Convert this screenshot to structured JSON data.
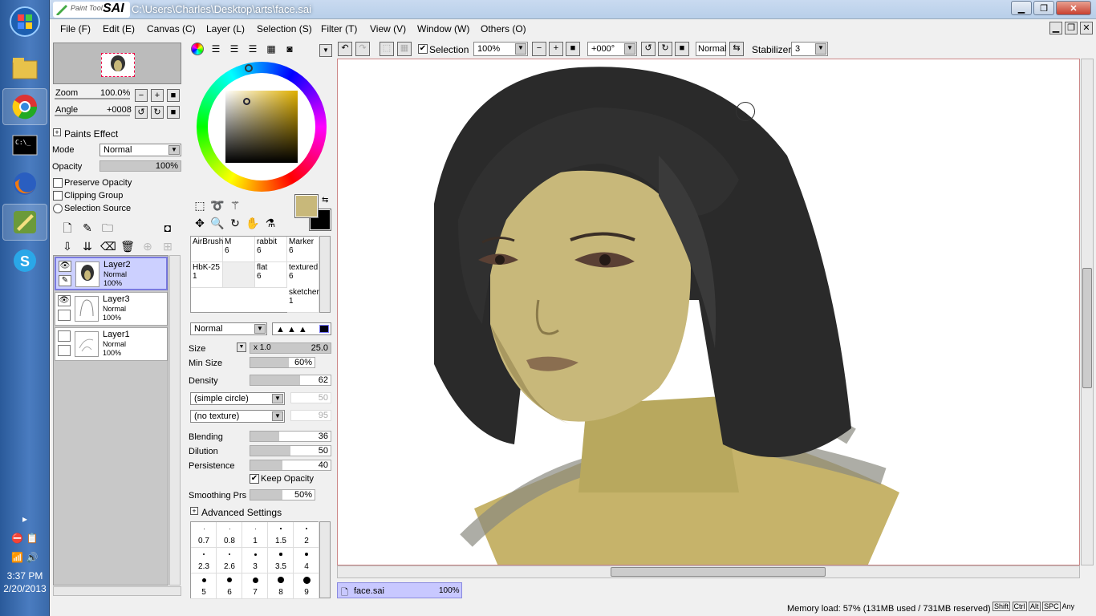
{
  "titlebar": {
    "path": "C:\\Users\\Charles\\Desktop\\arts\\face.sai",
    "logo_top": "Paint Tool",
    "logo_main": "SAI"
  },
  "menu": [
    "File (F)",
    "Edit (E)",
    "Canvas (C)",
    "Layer (L)",
    "Selection (S)",
    "Filter (T)",
    "View (V)",
    "Window (W)",
    "Others (O)"
  ],
  "toolbar": {
    "selection_label": "Selection",
    "zoom": "100%",
    "angle": "+000°",
    "blend": "Normal",
    "stabilizer_label": "Stabilizer",
    "stabilizer_value": "3"
  },
  "navigator": {
    "zoom_label": "Zoom",
    "zoom_value": "100.0%",
    "angle_label": "Angle",
    "angle_value": "+0008"
  },
  "paints_effect": {
    "title": "Paints Effect",
    "mode_label": "Mode",
    "mode_value": "Normal",
    "opacity_label": "Opacity",
    "opacity_value": "100%",
    "preserve_opacity": "Preserve Opacity",
    "clipping_group": "Clipping Group",
    "selection_source": "Selection Source"
  },
  "layers": [
    {
      "name": "Layer2",
      "mode": "Normal",
      "opacity": "100%"
    },
    {
      "name": "Layer3",
      "mode": "Normal",
      "opacity": "100%"
    },
    {
      "name": "Layer1",
      "mode": "Normal",
      "opacity": "100%"
    }
  ],
  "brushes": [
    {
      "name": "AirBrush",
      "size": ""
    },
    {
      "name": "M",
      "size": "6"
    },
    {
      "name": "rabbit",
      "size": "6"
    },
    {
      "name": "Marker",
      "size": "6"
    },
    {
      "name": "HbK-25",
      "size": "1"
    },
    {
      "name": "",
      "size": ""
    },
    {
      "name": "flat",
      "size": "6"
    },
    {
      "name": "textured",
      "size": "6"
    },
    {
      "name": "sketcher",
      "size": "1"
    }
  ],
  "tool_settings": {
    "blend_mode": "Normal",
    "size_label": "Size",
    "size_mult": "x 1.0",
    "size_value": "25.0",
    "min_size_label": "Min Size",
    "min_size_value": "60%",
    "density_label": "Density",
    "density_value": "62",
    "shape": "(simple circle)",
    "shape_value": "50",
    "texture": "(no texture)",
    "texture_value": "95",
    "blending_label": "Blending",
    "blending_value": "36",
    "dilution_label": "Dilution",
    "dilution_value": "50",
    "persistence_label": "Persistence",
    "persistence_value": "40",
    "keep_opacity": "Keep Opacity",
    "smoothing_label": "Smoothing Prs",
    "smoothing_value": "50%",
    "advanced": "Advanced Settings"
  },
  "brush_sizes": [
    "0.7",
    "0.8",
    "1",
    "1.5",
    "2",
    "2.3",
    "2.6",
    "3",
    "3.5",
    "4",
    "5",
    "6",
    "7",
    "8",
    "9"
  ],
  "document_tab": {
    "name": "face.sai",
    "zoom": "100%"
  },
  "status": {
    "memory": "Memory load: 57% (131MB used / 731MB reserved)",
    "keys": [
      "Shift",
      "Ctrl",
      "Alt",
      "SPC",
      "Any"
    ]
  },
  "clock": {
    "time": "3:37 PM",
    "date": "2/20/2013"
  },
  "colors": {
    "primary": "#c8b87a",
    "secondary": "#000000",
    "accent": "#7a7ae0"
  },
  "icons": [
    "windows-start-icon",
    "explorer-icon",
    "chrome-icon",
    "cmd-icon",
    "firefox-icon",
    "sai-icon",
    "skype-icon"
  ]
}
